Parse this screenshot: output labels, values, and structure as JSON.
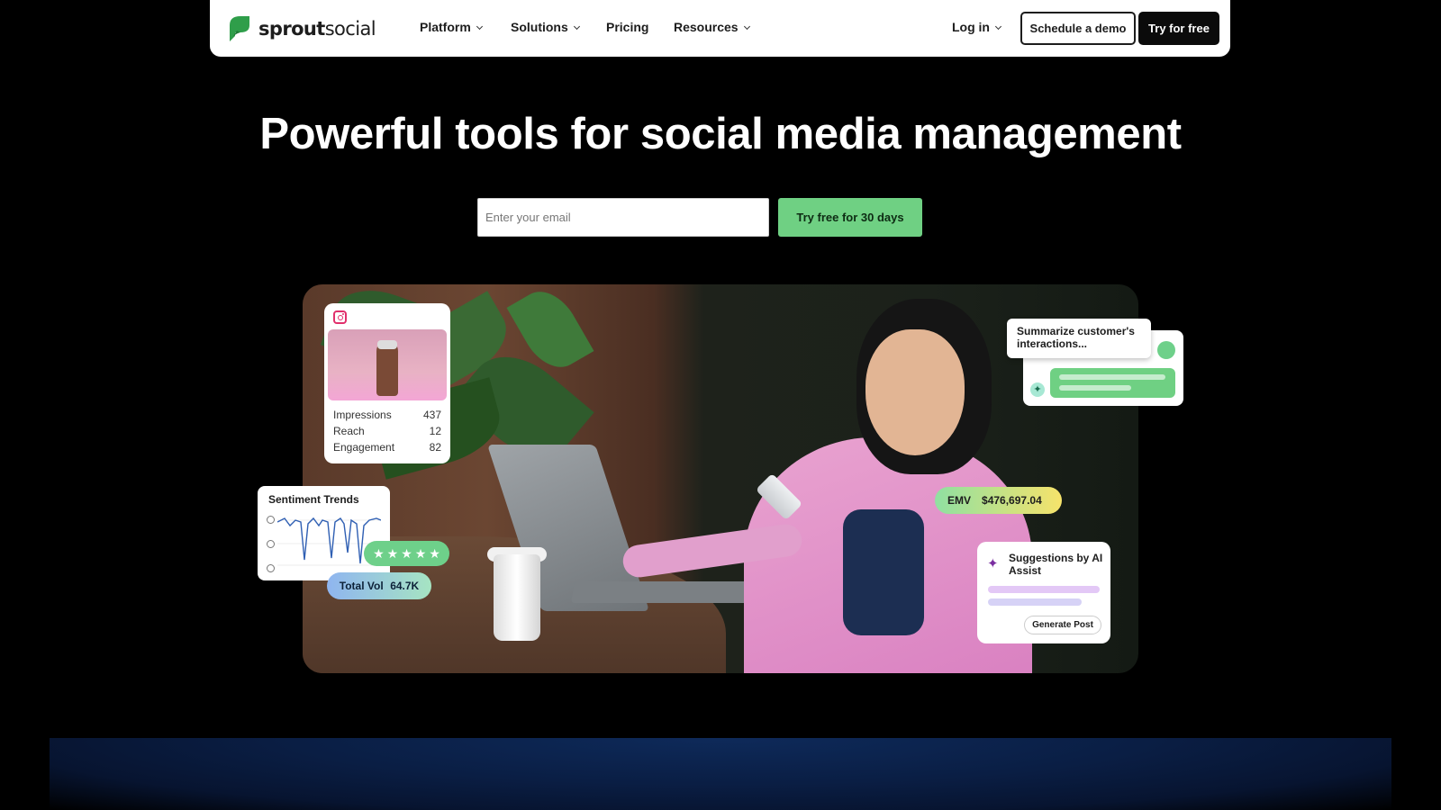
{
  "nav": {
    "logo_bold": "sprout",
    "logo_light": "social",
    "items": [
      {
        "label": "Platform",
        "dropdown": true
      },
      {
        "label": "Solutions",
        "dropdown": true
      },
      {
        "label": "Pricing",
        "dropdown": false
      },
      {
        "label": "Resources",
        "dropdown": true
      }
    ],
    "login": "Log in",
    "demo": "Schedule a demo",
    "try": "Try for free"
  },
  "hero": {
    "title": "Powerful tools for social media management",
    "email_placeholder": "Enter your email",
    "cta": "Try free for 30 days"
  },
  "cards": {
    "instagram": {
      "rows": [
        {
          "label": "Impressions",
          "value": "437"
        },
        {
          "label": "Reach",
          "value": "12"
        },
        {
          "label": "Engagement",
          "value": "82"
        }
      ]
    },
    "sentiment": {
      "title": "Sentiment Trends"
    },
    "total_vol": {
      "label": "Total Vol",
      "value": "64.7K"
    },
    "summarize": {
      "text": "Summarize customer's interactions..."
    },
    "emv": {
      "label": "EMV",
      "value": "$476,697.04"
    },
    "ai_assist": {
      "title": "Suggestions by AI Assist",
      "button": "Generate Post"
    }
  },
  "colors": {
    "brand_green": "#6fd083",
    "background": "#000000",
    "instagram": "#e1306c"
  }
}
